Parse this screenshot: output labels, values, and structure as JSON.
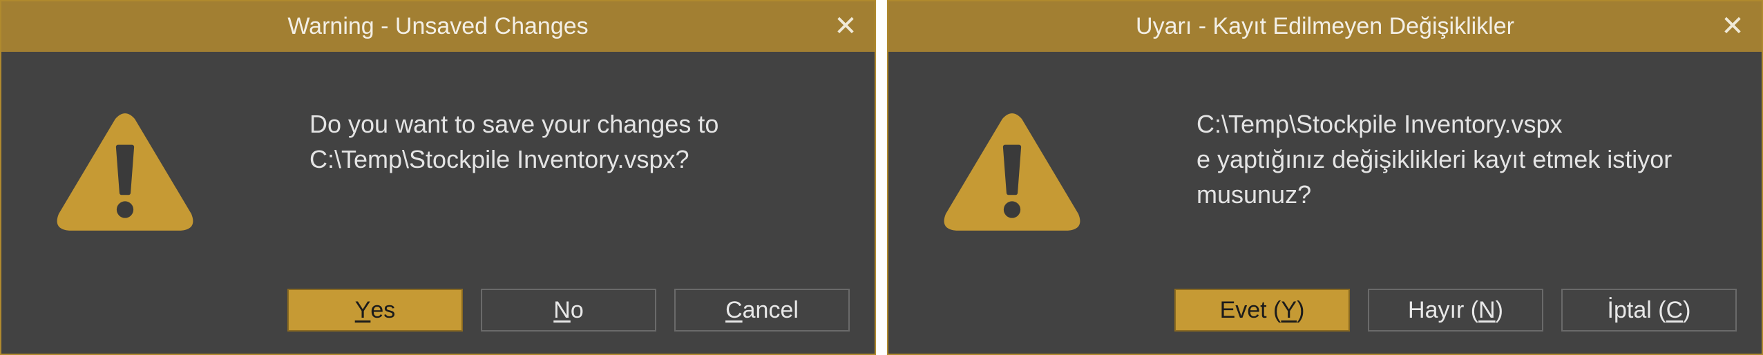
{
  "colors": {
    "titlebar": "#a27f32",
    "body": "#424242",
    "accent": "#c69a34",
    "border": "#b08a2e",
    "text": "#e4e4e4"
  },
  "dialogs": [
    {
      "title": "Warning - Unsaved Changes",
      "close_icon": "close-icon",
      "icon": "warning-triangle-icon",
      "message_lines": [
        "Do you want to save your changes to",
        "C:\\Temp\\Stockpile Inventory.vspx?",
        ""
      ],
      "buttons": [
        {
          "pre": "",
          "acc": "Y",
          "post": "es",
          "default": true
        },
        {
          "pre": "",
          "acc": "N",
          "post": "o",
          "default": false
        },
        {
          "pre": "",
          "acc": "C",
          "post": "ancel",
          "default": false
        }
      ]
    },
    {
      "title": "Uyarı - Kayıt Edilmeyen Değişiklikler",
      "close_icon": "close-icon",
      "icon": "warning-triangle-icon",
      "message_lines": [
        "C:\\Temp\\Stockpile Inventory.vspx",
        "e yaptığınız değişiklikleri kayıt etmek istiyor",
        "musunuz?"
      ],
      "buttons": [
        {
          "pre": "Evet (",
          "acc": "Y",
          "post": ")",
          "default": true
        },
        {
          "pre": "Hayır (",
          "acc": "N",
          "post": ")",
          "default": false
        },
        {
          "pre": "İptal (",
          "acc": "C",
          "post": ")",
          "default": false
        }
      ]
    }
  ]
}
